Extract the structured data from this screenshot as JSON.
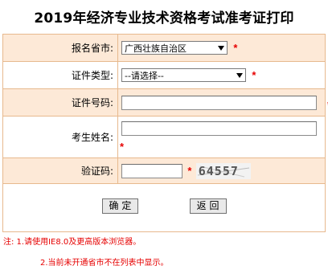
{
  "page": {
    "title": "2019年经济专业技术资格考试准考证打印"
  },
  "form": {
    "province": {
      "label": "报名省市:",
      "selected": "广西壮族自治区",
      "required_mark": "*"
    },
    "id_type": {
      "label": "证件类型:",
      "selected": "--请选择--",
      "required_mark": "*"
    },
    "id_number": {
      "label": "证件号码:",
      "value": "",
      "required_mark": "*"
    },
    "name": {
      "label": "考生姓名:",
      "value": "",
      "required_mark": "*"
    },
    "verify_code": {
      "label": "验证码:",
      "value": "",
      "required_mark": "*",
      "captcha_text": "64557"
    }
  },
  "buttons": {
    "confirm_label": "确 定",
    "back_label": "返 回"
  },
  "notes": {
    "line1": "注: 1.请使用IE8.0及更高版本浏览器。",
    "line2": "2.当前未开通省市不在列表中显示。"
  },
  "colors": {
    "accent_red": "#e60000",
    "row_shade": "#fde9d7",
    "border": "#e7b98e"
  },
  "icons": {
    "dropdown": "chevron-down-icon"
  }
}
